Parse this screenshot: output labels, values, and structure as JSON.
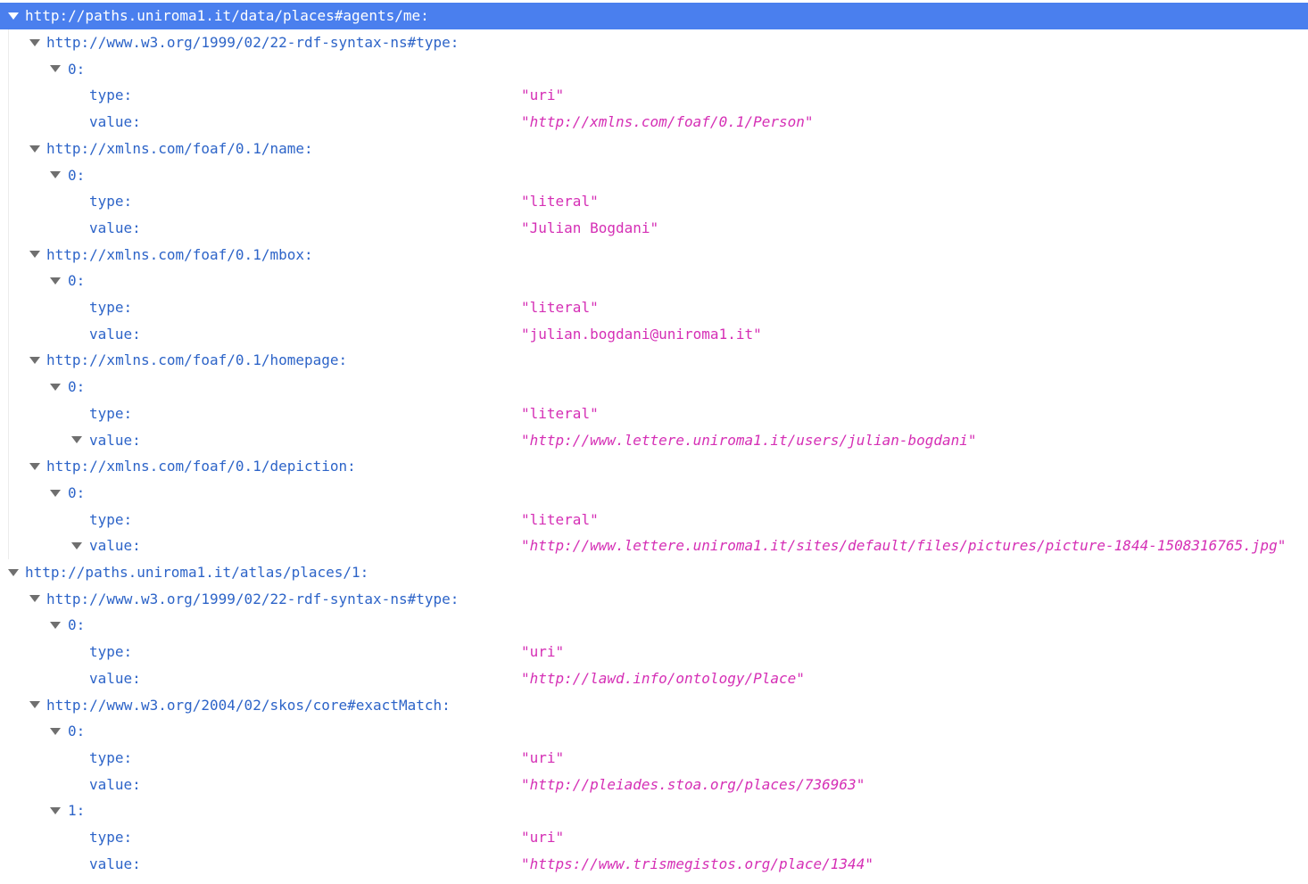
{
  "rows": [
    {
      "depth": 0,
      "twisty": true,
      "key": "http://paths.uniroma1.it/data/places#agents/me:",
      "selected": true
    },
    {
      "depth": 1,
      "twisty": true,
      "key": "http://www.w3.org/1999/02/22-rdf-syntax-ns#type:"
    },
    {
      "depth": 2,
      "twisty": true,
      "key": "0:"
    },
    {
      "depth": 3,
      "twisty": false,
      "key": "type:",
      "value": "uri",
      "link": false
    },
    {
      "depth": 3,
      "twisty": false,
      "key": "value:",
      "value": "http://xmlns.com/foaf/0.1/Person",
      "link": true
    },
    {
      "depth": 1,
      "twisty": true,
      "key": "http://xmlns.com/foaf/0.1/name:"
    },
    {
      "depth": 2,
      "twisty": true,
      "key": "0:"
    },
    {
      "depth": 3,
      "twisty": false,
      "key": "type:",
      "value": "literal",
      "link": false
    },
    {
      "depth": 3,
      "twisty": false,
      "key": "value:",
      "value": "Julian Bogdani",
      "link": false
    },
    {
      "depth": 1,
      "twisty": true,
      "key": "http://xmlns.com/foaf/0.1/mbox:"
    },
    {
      "depth": 2,
      "twisty": true,
      "key": "0:"
    },
    {
      "depth": 3,
      "twisty": false,
      "key": "type:",
      "value": "literal",
      "link": false
    },
    {
      "depth": 3,
      "twisty": false,
      "key": "value:",
      "value": "julian.bogdani@uniroma1.it",
      "link": false
    },
    {
      "depth": 1,
      "twisty": true,
      "key": "http://xmlns.com/foaf/0.1/homepage:"
    },
    {
      "depth": 2,
      "twisty": true,
      "key": "0:"
    },
    {
      "depth": 3,
      "twisty": false,
      "key": "type:",
      "value": "literal",
      "link": false
    },
    {
      "depth": 3,
      "twisty": true,
      "key": "value:",
      "value": "http://www.lettere.uniroma1.it/users/julian-bogdani",
      "link": true
    },
    {
      "depth": 1,
      "twisty": true,
      "key": "http://xmlns.com/foaf/0.1/depiction:"
    },
    {
      "depth": 2,
      "twisty": true,
      "key": "0:"
    },
    {
      "depth": 3,
      "twisty": false,
      "key": "type:",
      "value": "literal",
      "link": false
    },
    {
      "depth": 3,
      "twisty": true,
      "key": "value:",
      "value": "http://www.lettere.uniroma1.it/sites/default/files/pictures/picture-1844-1508316765.jpg",
      "link": true
    },
    {
      "depth": 0,
      "twisty": true,
      "key": "http://paths.uniroma1.it/atlas/places/1:"
    },
    {
      "depth": 1,
      "twisty": true,
      "key": "http://www.w3.org/1999/02/22-rdf-syntax-ns#type:"
    },
    {
      "depth": 2,
      "twisty": true,
      "key": "0:"
    },
    {
      "depth": 3,
      "twisty": false,
      "key": "type:",
      "value": "uri",
      "link": false
    },
    {
      "depth": 3,
      "twisty": false,
      "key": "value:",
      "value": "http://lawd.info/ontology/Place",
      "link": true
    },
    {
      "depth": 1,
      "twisty": true,
      "key": "http://www.w3.org/2004/02/skos/core#exactMatch:"
    },
    {
      "depth": 2,
      "twisty": true,
      "key": "0:"
    },
    {
      "depth": 3,
      "twisty": false,
      "key": "type:",
      "value": "uri",
      "link": false
    },
    {
      "depth": 3,
      "twisty": false,
      "key": "value:",
      "value": "http://pleiades.stoa.org/places/736963",
      "link": true
    },
    {
      "depth": 2,
      "twisty": true,
      "key": "1:"
    },
    {
      "depth": 3,
      "twisty": false,
      "key": "type:",
      "value": "uri",
      "link": false
    },
    {
      "depth": 3,
      "twisty": false,
      "key": "value:",
      "value": "https://www.trismegistos.org/place/1344",
      "link": true
    }
  ]
}
